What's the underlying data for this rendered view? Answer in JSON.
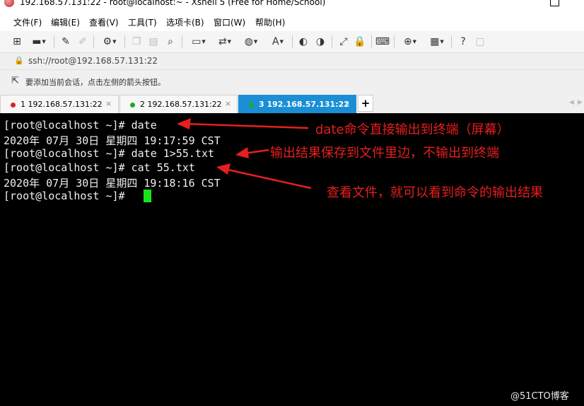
{
  "window": {
    "title": "192.168.57.131:22 - root@localhost:~ - Xshell 5 (Free for Home/School)"
  },
  "menu": [
    "文件(F)",
    "编辑(E)",
    "查看(V)",
    "工具(T)",
    "选项卡(B)",
    "窗口(W)",
    "帮助(H)"
  ],
  "address": "ssh://root@192.168.57.131:22",
  "hint": "要添加当前会话，点击左侧的箭头按钮。",
  "tabs": [
    {
      "label": "1 192.168.57.131:22",
      "status_color": "#e02020",
      "active": false
    },
    {
      "label": "2 192.168.57.131:22",
      "status_color": "#1faa1f",
      "active": false
    },
    {
      "label": "3 192.168.57.131:22",
      "status_color": "#1faa1f",
      "active": true
    }
  ],
  "terminal": {
    "lines": [
      "[root@localhost ~]# date",
      "2020年 07月 30日 星期四 19:17:59 CST",
      "[root@localhost ~]# date 1>55.txt",
      "[root@localhost ~]# cat 55.txt",
      "2020年 07月 30日 星期四 19:18:16 CST",
      "[root@localhost ~]# "
    ],
    "cursor_color": "#19e619"
  },
  "annotations": [
    "date命令直接输出到终端（屏幕）",
    "输出结果保存到文件里边，不输出到终端",
    "查看文件，就可以看到命令的输出结果"
  ],
  "annotation_color": "#e81e1e",
  "watermark": "@51CTO博客"
}
